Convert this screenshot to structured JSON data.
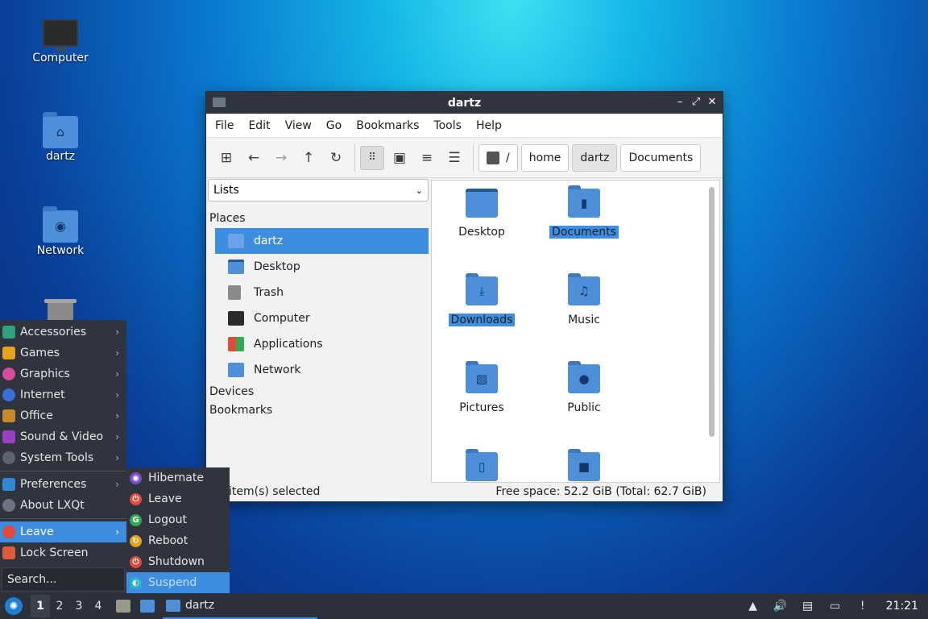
{
  "desktop": {
    "icons": [
      {
        "label": "Computer",
        "icon": "computer-icon"
      },
      {
        "label": "dartz",
        "icon": "home-folder-icon"
      },
      {
        "label": "Network",
        "icon": "network-folder-icon"
      },
      {
        "label": "",
        "icon": "trash-icon"
      }
    ]
  },
  "window": {
    "title": "dartz",
    "controls": {
      "minimize": "–",
      "maximize": "⤢",
      "close": "✕"
    },
    "menu": [
      "File",
      "Edit",
      "View",
      "Go",
      "Bookmarks",
      "Tools",
      "Help"
    ],
    "breadcrumb": {
      "root": "/",
      "parts": [
        "home",
        "dartz",
        "Documents"
      ],
      "current": "dartz"
    },
    "sidebar": {
      "view_select": "Lists",
      "sections": {
        "places": "Places",
        "devices": "Devices",
        "bookmarks": "Bookmarks"
      },
      "places": [
        {
          "label": "dartz",
          "icon": "home-icon",
          "selected": true
        },
        {
          "label": "Desktop",
          "icon": "desktop-icon",
          "selected": false
        },
        {
          "label": "Trash",
          "icon": "trash-icon",
          "selected": false
        },
        {
          "label": "Computer",
          "icon": "computer-icon",
          "selected": false
        },
        {
          "label": "Applications",
          "icon": "applications-icon",
          "selected": false
        },
        {
          "label": "Network",
          "icon": "network-icon",
          "selected": false
        }
      ]
    },
    "files": [
      {
        "label": "Desktop",
        "selected": false,
        "glyph": ""
      },
      {
        "label": "Documents",
        "selected": true,
        "glyph": "▮"
      },
      {
        "label": "Downloads",
        "selected": true,
        "glyph": "⤓"
      },
      {
        "label": "Music",
        "selected": false,
        "glyph": "♫"
      },
      {
        "label": "Pictures",
        "selected": false,
        "glyph": "▧"
      },
      {
        "label": "Public",
        "selected": false,
        "glyph": "●"
      },
      {
        "label": "",
        "selected": false,
        "glyph": "▯"
      },
      {
        "label": "",
        "selected": false,
        "glyph": "■"
      }
    ],
    "status": {
      "left": "item(s) selected",
      "right": "Free space: 52.2 GiB (Total: 62.7 GiB)"
    }
  },
  "app_menu": {
    "items": [
      {
        "label": "Accessories",
        "color": "#2fa37a",
        "has_sub": true
      },
      {
        "label": "Games",
        "color": "#e8a21a",
        "has_sub": true
      },
      {
        "label": "Graphics",
        "color": "#d64b9a",
        "has_sub": true
      },
      {
        "label": "Internet",
        "color": "#3b6fd8",
        "has_sub": true
      },
      {
        "label": "Office",
        "color": "#c98a2b",
        "has_sub": true
      },
      {
        "label": "Sound & Video",
        "color": "#9a3fc1",
        "has_sub": true
      },
      {
        "label": "System Tools",
        "color": "#5c6370",
        "has_sub": true
      }
    ],
    "items2": [
      {
        "label": "Preferences",
        "color": "#2e8ad6",
        "has_sub": true
      },
      {
        "label": "About LXQt",
        "color": "#6c7380",
        "has_sub": false
      }
    ],
    "items3": [
      {
        "label": "Leave",
        "color": "#e04b3c",
        "has_sub": true,
        "selected": true
      },
      {
        "label": "Lock Screen",
        "color": "#e05a3c",
        "has_sub": false,
        "selected": false
      }
    ],
    "search_placeholder": "Search..."
  },
  "leave_menu": [
    {
      "label": "Hibernate",
      "color": "#7c4dc7",
      "sym": "◉",
      "selected": false
    },
    {
      "label": "Leave",
      "color": "#e04b3c",
      "sym": "⏻",
      "selected": false
    },
    {
      "label": "Logout",
      "color": "#35a853",
      "sym": "G",
      "selected": false
    },
    {
      "label": "Reboot",
      "color": "#e8a21a",
      "sym": "↻",
      "selected": false
    },
    {
      "label": "Shutdown",
      "color": "#e04b3c",
      "sym": "⏻",
      "selected": false
    },
    {
      "label": "Suspend",
      "color": "#2bb3c7",
      "sym": "◐",
      "selected": true
    }
  ],
  "taskbar": {
    "workspaces": [
      "1",
      "2",
      "3",
      "4"
    ],
    "current_workspace": "1",
    "task_label": "dartz",
    "clock": "21:21"
  }
}
